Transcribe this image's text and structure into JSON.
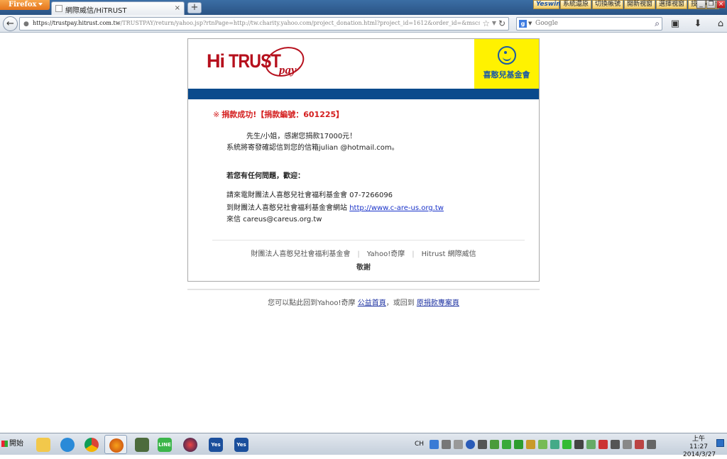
{
  "browser": {
    "menu_button": "Firefox",
    "tab_title": "網際威信/HiTRUST",
    "tab_close": "×",
    "new_tab": "+",
    "url_host": "https://trustpay.hitrust.com.tw",
    "url_path": "/TRUSTPAY/return/yahoo.jsp?rtnPage=http://tw.charity.yahoo.com/project_donation.html?project_id=1612&order_id=&mscssid=&retcode=00&order",
    "search_engine": "g",
    "search_placeholder": "Google",
    "bookmarks": [
      "Yeswin",
      "系統還原",
      "切換帳號",
      "開新視窗",
      "選擇視窗",
      "技術分析"
    ],
    "window_controls": [
      "_",
      "❐",
      "×"
    ]
  },
  "page": {
    "logo_hi": "Hi",
    "logo_trust": "TRUST",
    "logo_pay": "pay",
    "partner_name": "喜憨兒基金會",
    "success_mark": "※",
    "success_text": "捐款成功!【捐款編號：601225】",
    "thanks_text": "先生/小姐，感謝您捐款17000元！",
    "email_note": "系統將寄發確認信到您的信箱julian      @hotmail.com。",
    "questions_heading": "若您有任何問題，歡迎：",
    "contact_phone": "請來電財團法人喜憨兒社會福利基金會 07-7266096",
    "contact_site_prefix": "到財團法人喜憨兒社會福利基金會網站 ",
    "contact_site_link": "http://www.c-are-us.org.tw",
    "contact_email": "來信 careus@careus.org.tw",
    "footer_orgs": [
      "財團法人喜憨兒社會福利基金會",
      "Yahoo!奇摩",
      "Hitrust 網際威信"
    ],
    "footer_sep": "|",
    "regards": "敬謝",
    "return_prefix": "您可以點此回到Yahoo!奇摩 ",
    "return_link1": "公益首頁",
    "return_middle": "，或回到 ",
    "return_link2": "原捐款專案頁"
  },
  "taskbar": {
    "start_label": "開始",
    "ime": "CH",
    "clock_time": "上午 11:27",
    "clock_date": "2014/3/27",
    "apps": [
      "file-explorer",
      "internet-explorer",
      "chrome",
      "firefox",
      "stock-app",
      "line",
      "hitrust",
      "yeswin",
      "yeswin-2"
    ],
    "app_labels": {
      "line": "LINE",
      "yeswin": "Yes",
      "yeswin-2": "Yes"
    }
  },
  "colors": {
    "brand_red": "#b6101d",
    "band_blue": "#0a4a8c",
    "partner_yellow": "#fff200",
    "success_red": "#d41d1d"
  }
}
